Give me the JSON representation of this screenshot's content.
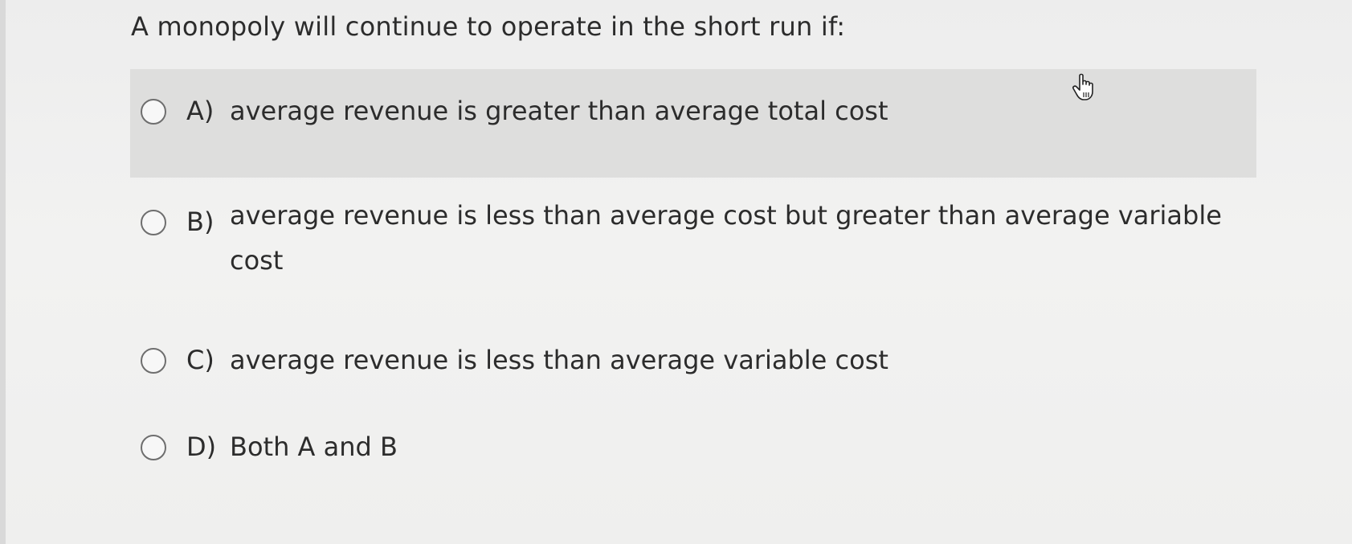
{
  "question": {
    "text": "A monopoly will continue to operate in the short run if:"
  },
  "options": [
    {
      "letter": "A)",
      "text": "average revenue is greater than average total cost",
      "selected": false,
      "hovered": true
    },
    {
      "letter": "B)",
      "text": "average revenue is less than average cost but greater than average variable cost",
      "selected": false,
      "hovered": false
    },
    {
      "letter": "C)",
      "text": "average revenue is less than average variable cost",
      "selected": false,
      "hovered": false
    },
    {
      "letter": "D)",
      "text": "Both A and B",
      "selected": false,
      "hovered": false
    }
  ],
  "cursor": {
    "icon": "hand-pointer-icon"
  },
  "colors": {
    "background": "#efefee",
    "hover_row": "#dededd",
    "text": "#2c2c2c",
    "radio_border": "#6e6e6e"
  }
}
